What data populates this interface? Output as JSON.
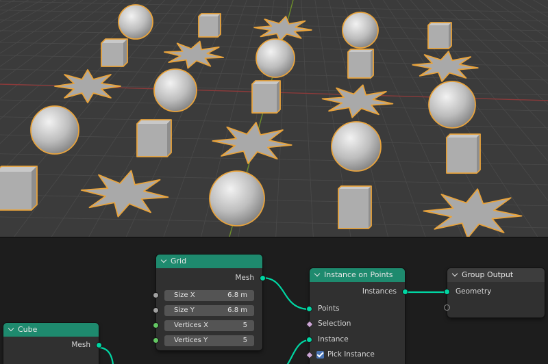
{
  "nodes": {
    "grid": {
      "title": "Grid",
      "output": "Mesh",
      "fields": [
        {
          "label": "Size X",
          "value": "6.8 m"
        },
        {
          "label": "Size Y",
          "value": "6.8 m"
        },
        {
          "label": "Vertices X",
          "value": "5"
        },
        {
          "label": "Vertices Y",
          "value": "5"
        }
      ]
    },
    "cube": {
      "title": "Cube",
      "output": "Mesh"
    },
    "instance_on_points": {
      "title": "Instance on Points",
      "output": "Instances",
      "inputs": [
        "Points",
        "Selection",
        "Instance"
      ],
      "pick_instance_label": "Pick Instance",
      "pick_instance_checked": true
    },
    "group_output": {
      "title": "Group Output",
      "input": "Geometry"
    }
  },
  "colors": {
    "geometry_socket": "#00d6a3",
    "geometry_header": "#1e8a6e",
    "selection_outline": "#e8a33c",
    "viewport_bg": "#3b3b3b",
    "node_editor_bg": "#1d1d1d"
  },
  "icons": [
    "chevron-down-icon",
    "checkbox-checked-icon"
  ]
}
